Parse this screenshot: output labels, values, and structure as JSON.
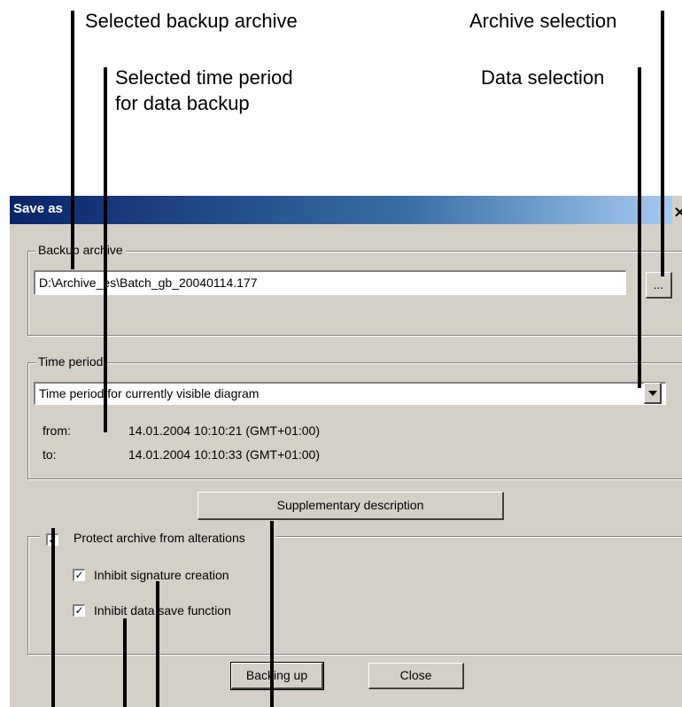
{
  "callouts": {
    "selected_backup_archive": "Selected backup archive",
    "archive_selection": "Archive selection",
    "selected_time_period_line1": "Selected time period",
    "selected_time_period_line2": "for data backup",
    "data_selection": "Data selection"
  },
  "dialog": {
    "title": "Save as",
    "close_glyph": "×"
  },
  "backup_archive": {
    "legend": "Backup archive",
    "path": "D:\\Archive_es\\Batch_gb_20040114.177",
    "browse_label": "..."
  },
  "time_period": {
    "legend": "Time period",
    "selected": "Time period for currently visible diagram",
    "from_label": "from:",
    "from_value": "14.01.2004 10:10:21 (GMT+01:00)",
    "to_label": "to:",
    "to_value": "14.01.2004 10:10:33 (GMT+01:00)"
  },
  "supplementary_button": "Supplementary description",
  "protect": {
    "label": "Protect archive from alterations",
    "checked_glyph": "✓",
    "inhibit_signature": "Inhibit signature creation",
    "inhibit_data_save": "Inhibit data save function"
  },
  "buttons": {
    "backing_up": "Backing up",
    "close": "Close"
  }
}
